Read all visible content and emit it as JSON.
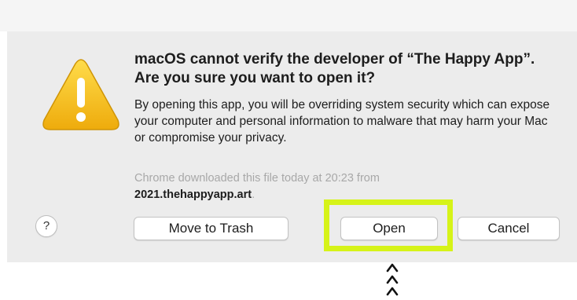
{
  "dialog": {
    "title": "macOS cannot verify the developer of “The Happy App”. Are you sure you want to open it?",
    "body": "By opening this app, you will be overriding system security which can expose your computer and personal information to malware that may harm your Mac or compromise your privacy.",
    "source_prefix": "Chrome downloaded this file today at 20:23 from",
    "source_host": "2021.thehappyapp.art",
    "source_suffix": "."
  },
  "buttons": {
    "help_label": "?",
    "move_to_trash": "Move to Trash",
    "open": "Open",
    "cancel": "Cancel"
  },
  "icons": {
    "warning": "warning-triangle-icon",
    "help": "help-icon",
    "arrows": "chevron-up-icon"
  },
  "colors": {
    "dialog_background": "#ececec",
    "highlight": "#d6f318",
    "warning_yellow": "#f5c11b"
  }
}
